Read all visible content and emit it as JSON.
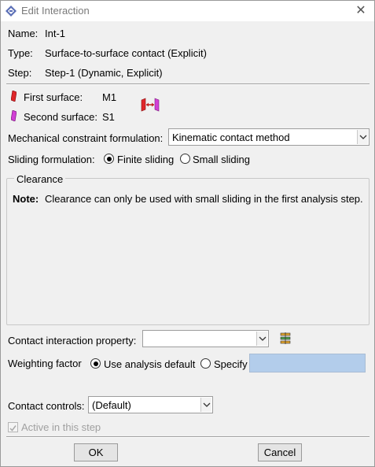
{
  "window": {
    "title": "Edit Interaction"
  },
  "info": {
    "name_label": "Name:",
    "name_value": "Int-1",
    "type_label": "Type:",
    "type_value": "Surface-to-surface contact (Explicit)",
    "step_label": "Step:",
    "step_value": "Step-1 (Dynamic, Explicit)"
  },
  "surfaces": {
    "first_label": "First surface:",
    "first_value": "M1",
    "second_label": "Second surface:",
    "second_value": "S1",
    "first_color": "#e0262a",
    "second_color": "#d23fd6",
    "swap_icon": "swap-surfaces-icon"
  },
  "constraint": {
    "label": "Mechanical constraint formulation:",
    "selected": "Kinematic contact method"
  },
  "sliding": {
    "label": "Sliding formulation:",
    "options": [
      "Finite sliding",
      "Small sliding"
    ],
    "selected": "Finite sliding"
  },
  "clearance": {
    "title": "Clearance",
    "note_label": "Note:",
    "note_text": "Clearance can only be used with small sliding in the first analysis step."
  },
  "property": {
    "label": "Contact interaction property:",
    "selected": "",
    "create_icon": "create-property-icon"
  },
  "weighting": {
    "label": "Weighting factor",
    "options": [
      "Use analysis default",
      "Specify"
    ],
    "selected": "Use analysis default",
    "value": ""
  },
  "controls": {
    "label": "Contact controls:",
    "selected": "(Default)"
  },
  "active": {
    "label": "Active in this step",
    "checked": true
  },
  "buttons": {
    "ok": "OK",
    "cancel": "Cancel"
  }
}
